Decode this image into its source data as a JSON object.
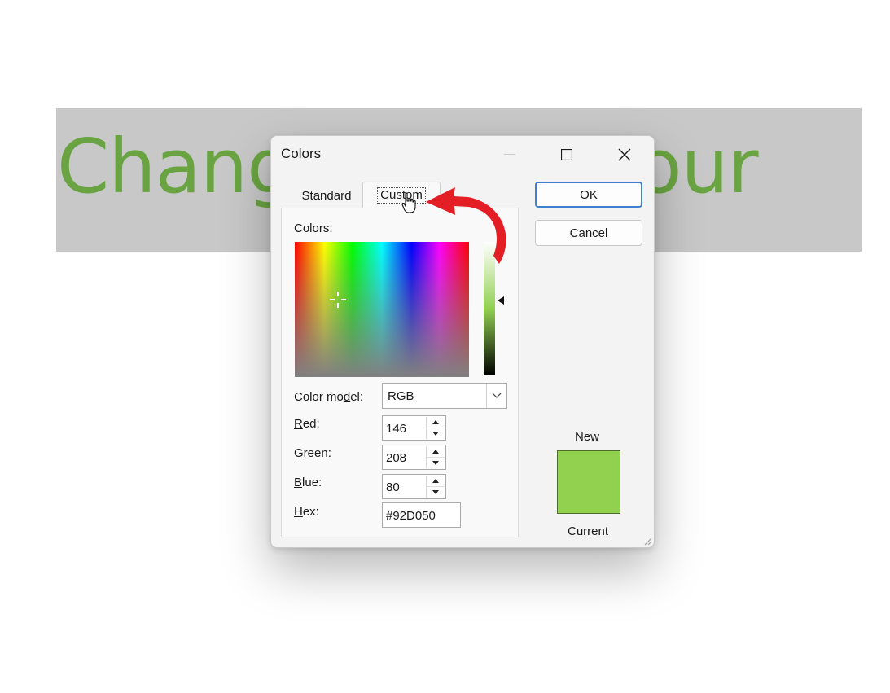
{
  "slide": {
    "title": "Change font colour"
  },
  "dialog": {
    "title": "Colors",
    "tabs": [
      {
        "label": "Standard"
      },
      {
        "label": "Custom"
      }
    ],
    "colors_label": "Colors:",
    "color_model": {
      "label": "Color model:",
      "value": "RGB"
    },
    "fields": {
      "red": {
        "label": "Red:",
        "value": "146"
      },
      "green": {
        "label": "Green:",
        "value": "208"
      },
      "blue": {
        "label": "Blue:",
        "value": "80"
      },
      "hex": {
        "label": "Hex:",
        "value": "#92D050"
      }
    },
    "ok_label": "OK",
    "cancel_label": "Cancel",
    "new_label": "New",
    "current_label": "Current",
    "new_color": "#92D050",
    "title_text_color": "#6AA442",
    "annotation_arrow_color": "#E31E24"
  }
}
